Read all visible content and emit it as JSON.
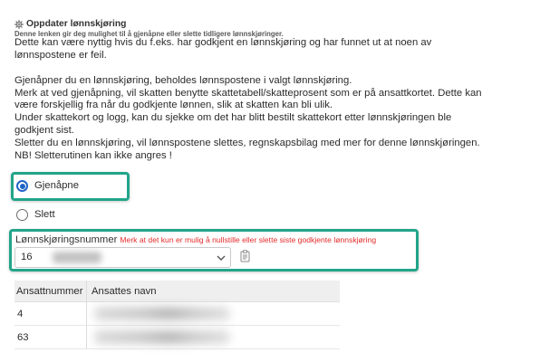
{
  "header": {
    "icon": "gear-icon",
    "title": "Oppdater lønnskjøring",
    "subtitle": "Denne lenken gir deg mulighet til å gjenåpne eller slette tidligere lønnskjøringer."
  },
  "description": {
    "paragraph_1": [
      "Dette kan være nyttig hvis du f.eks. har godkjent en lønnskjøring og har funnet ut at noen av",
      "lønnspostene er feil."
    ],
    "paragraph_2": [
      "Gjenåpner du en lønnskjøring, beholdes lønnspostene i valgt lønnskjøring.",
      "Merk at ved gjenåpning, vil skatten benytte skattetabell/skatteprosent som er på ansattkortet. Dette kan",
      "være forskjellig fra når du godkjente lønnen, slik at skatten kan bli ulik.",
      "Under skattekort og logg, kan du sjekke om det har blitt bestilt skattekort etter lønnskjøringen ble",
      "godkjent sist.",
      "Sletter du en lønnskjøring, vil lønnspostene slettes, regnskapsbilag med mer for denne lønnskjøringen.",
      "NB! Sletterutinen kan ikke angres !"
    ]
  },
  "action": {
    "options": [
      {
        "label": "Gjenåpne",
        "selected": true
      },
      {
        "label": "Slett",
        "selected": false
      }
    ]
  },
  "payroll_run": {
    "label": "Lønnskjøringsnummer",
    "warning": "Merk at det kun er mulig å nullstille eller slette siste godkjente lønnskjøring",
    "selected_value": "16",
    "dropdown_icon": "chevron-down-icon",
    "side_icon": "clipboard-icon"
  },
  "employees_table": {
    "columns": [
      "Ansattnummer",
      "Ansattes navn"
    ],
    "rows": [
      {
        "employee_number": "4"
      },
      {
        "employee_number": "63"
      }
    ]
  },
  "colors": {
    "highlight_border": "#22a58a",
    "radio_selected": "#1f63c6",
    "warning_text": "#e32b2b",
    "text": "#2b2b2b"
  }
}
